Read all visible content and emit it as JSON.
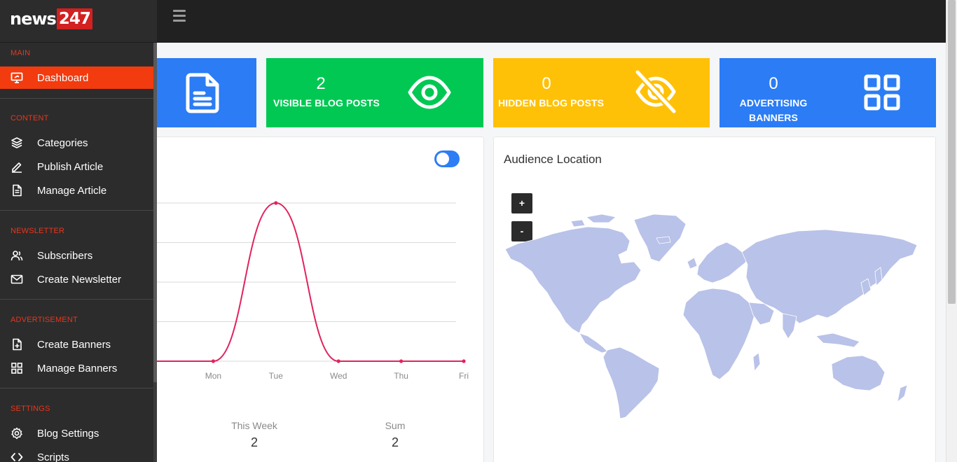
{
  "brand": {
    "name_part1": "news",
    "name_part2": "247"
  },
  "sidebar": {
    "sections": [
      {
        "title": "MAIN",
        "items": [
          {
            "label": "Dashboard",
            "icon": "monitor-icon",
            "active": true
          }
        ]
      },
      {
        "title": "CONTENT",
        "items": [
          {
            "label": "Categories",
            "icon": "layers-icon"
          },
          {
            "label": "Publish Article",
            "icon": "pen-icon"
          },
          {
            "label": "Manage Article",
            "icon": "document-icon"
          }
        ]
      },
      {
        "title": "NEWSLETTER",
        "items": [
          {
            "label": "Subscribers",
            "icon": "users-icon"
          },
          {
            "label": "Create Newsletter",
            "icon": "mail-icon"
          }
        ]
      },
      {
        "title": "ADVERTISEMENT",
        "items": [
          {
            "label": "Create Banners",
            "icon": "file-plus-icon"
          },
          {
            "label": "Manage Banners",
            "icon": "grid-icon"
          }
        ]
      },
      {
        "title": "SETTINGS",
        "items": [
          {
            "label": "Blog Settings",
            "icon": "gear-icon"
          },
          {
            "label": "Scripts",
            "icon": "code-icon"
          }
        ]
      }
    ]
  },
  "stats": [
    {
      "value": "",
      "label": "",
      "color": "#2b7cf5",
      "icon": "document-icon"
    },
    {
      "value": "2",
      "label": "VISIBLE BLOG POSTS",
      "color": "#00c853",
      "icon": "eye-icon"
    },
    {
      "value": "0",
      "label": "HIDDEN BLOG POSTS",
      "color": "#ffc107",
      "icon": "eye-off-icon"
    },
    {
      "value": "0",
      "label": "ADVERTISING BANNERS",
      "label_line1": "ADVERTISING",
      "label_line2": "BANNERS",
      "color": "#2b7cf5",
      "icon": "grid-icon"
    }
  ],
  "chart_data": {
    "type": "line",
    "categories": [
      "Mon",
      "Tue",
      "Wed",
      "Thu",
      "Fri"
    ],
    "x": [
      "",
      "Mon",
      "Tue",
      "Wed",
      "Thu",
      "Fri"
    ],
    "values": [
      0,
      0,
      2,
      0,
      0,
      0
    ],
    "ylim": [
      0,
      2
    ],
    "grid": true,
    "color": "#e0245e"
  },
  "chart_footer": [
    {
      "title": "This Week",
      "value": "2"
    },
    {
      "title": "Sum",
      "value": "2"
    }
  ],
  "map": {
    "title": "Audience Location",
    "zoom_in": "+",
    "zoom_out": "-",
    "land_color": "#b9c2e8"
  }
}
